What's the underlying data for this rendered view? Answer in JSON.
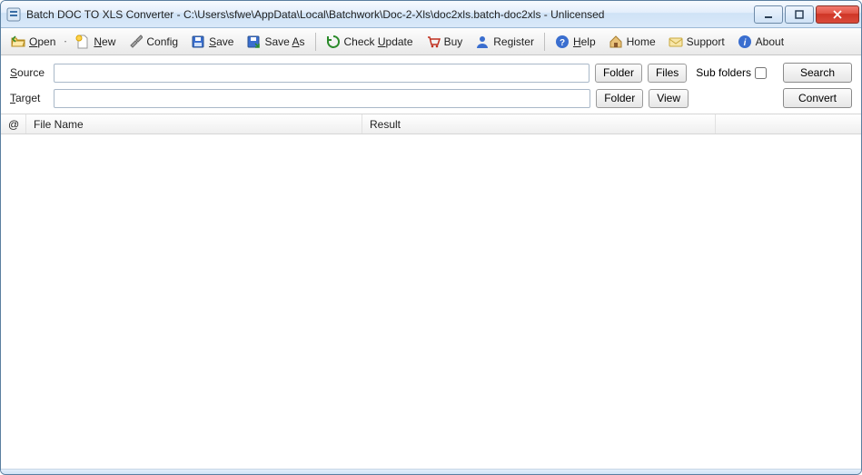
{
  "window": {
    "title": "Batch DOC TO XLS Converter - C:\\Users\\sfwe\\AppData\\Local\\Batchwork\\Doc-2-Xls\\doc2xls.batch-doc2xls - Unlicensed"
  },
  "toolbar": {
    "open": "Open",
    "new": "New",
    "config": "Config",
    "save": "Save",
    "save_as": "Save As",
    "check_update": "Check Update",
    "buy": "Buy",
    "register": "Register",
    "help": "Help",
    "home": "Home",
    "support": "Support",
    "about": "About"
  },
  "io": {
    "source_label": "Source",
    "source_value": "",
    "target_label": "Target",
    "target_value": "",
    "folder_btn": "Folder",
    "files_btn": "Files",
    "view_btn": "View",
    "subfolders_label": "Sub folders",
    "subfolders_checked": false,
    "search_btn": "Search",
    "convert_btn": "Convert"
  },
  "grid": {
    "col_at": "@",
    "col_filename": "File Name",
    "col_result": "Result",
    "rows": []
  }
}
